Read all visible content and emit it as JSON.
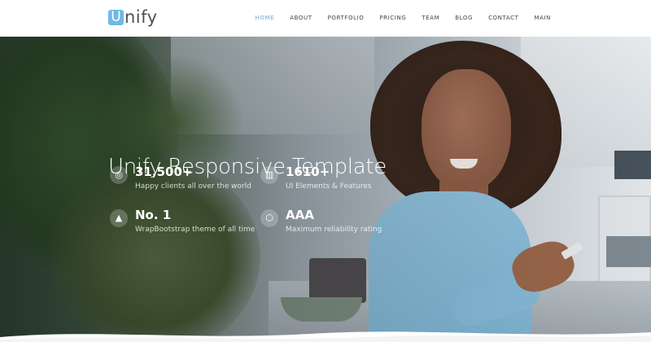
{
  "brand": {
    "logo_letter": "U",
    "logo_rest": "nify",
    "accent_color": "#6eb9e6"
  },
  "nav": {
    "items": [
      {
        "label": "HOME",
        "active": true
      },
      {
        "label": "ABOUT"
      },
      {
        "label": "PORTFOLIO"
      },
      {
        "label": "PRICING"
      },
      {
        "label": "TEAM"
      },
      {
        "label": "BLOG"
      },
      {
        "label": "CONTACT"
      },
      {
        "label": "MAIN"
      }
    ]
  },
  "hero": {
    "title": "Unify Responsive Template",
    "stats": [
      {
        "icon": "globe-icon",
        "glyph": "◎",
        "number": "31,500+",
        "text": "Happy clients all over the world"
      },
      {
        "icon": "bar-chart-icon",
        "glyph": "▥",
        "number": "1610+",
        "text": "UI Elements & Features"
      },
      {
        "icon": "pyramid-icon",
        "glyph": "▲",
        "number": "No. 1",
        "text": "WrapBootstrap theme of all time"
      },
      {
        "icon": "shield-icon",
        "glyph": "⬡",
        "number": "AAA",
        "text": "Maximum reliability rating"
      }
    ]
  }
}
